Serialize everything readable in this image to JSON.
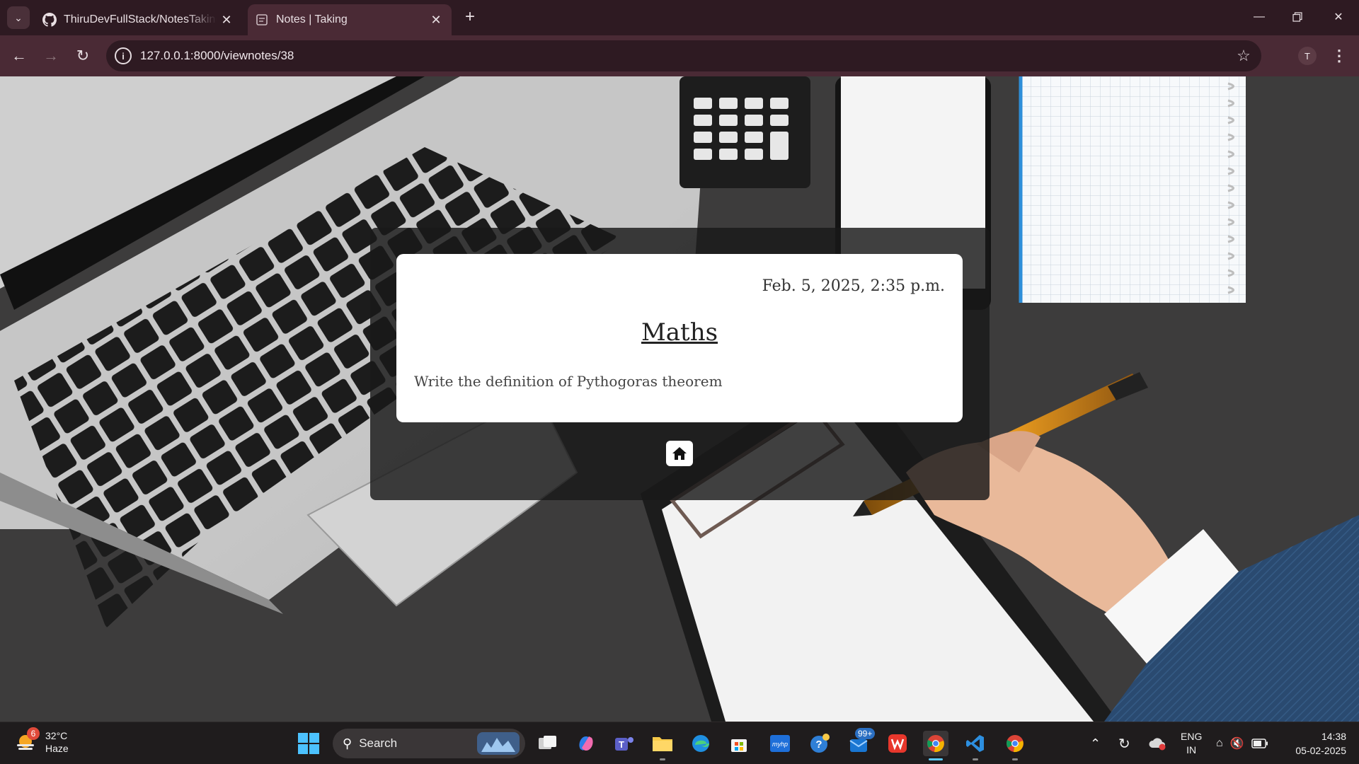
{
  "browser": {
    "tabs": [
      {
        "title": "ThiruDevFullStack/NotesTaking/",
        "icon": "github-icon",
        "active": false
      },
      {
        "title": "Notes | Taking",
        "icon": "page-icon",
        "active": true
      }
    ],
    "url": "127.0.0.1:8000/viewnotes/38",
    "profile_initial": "T"
  },
  "note": {
    "date": "Feb. 5, 2025, 2:35 p.m.",
    "title": "Maths",
    "body": "Write the definition of Pythogoras theorem"
  },
  "taskbar": {
    "weather": {
      "temp": "32°C",
      "condition": "Haze",
      "badge": "6"
    },
    "search_placeholder": "Search",
    "mail_badge": "99+",
    "language": {
      "line1": "ENG",
      "line2": "IN"
    },
    "time": "14:38",
    "date": "05-02-2025"
  },
  "colors": {
    "tabbar": "#2e1a22",
    "toolbar": "#4a2a35",
    "overlay": "#191919",
    "card": "#ffffff",
    "taskbar": "#1f1c1d"
  }
}
